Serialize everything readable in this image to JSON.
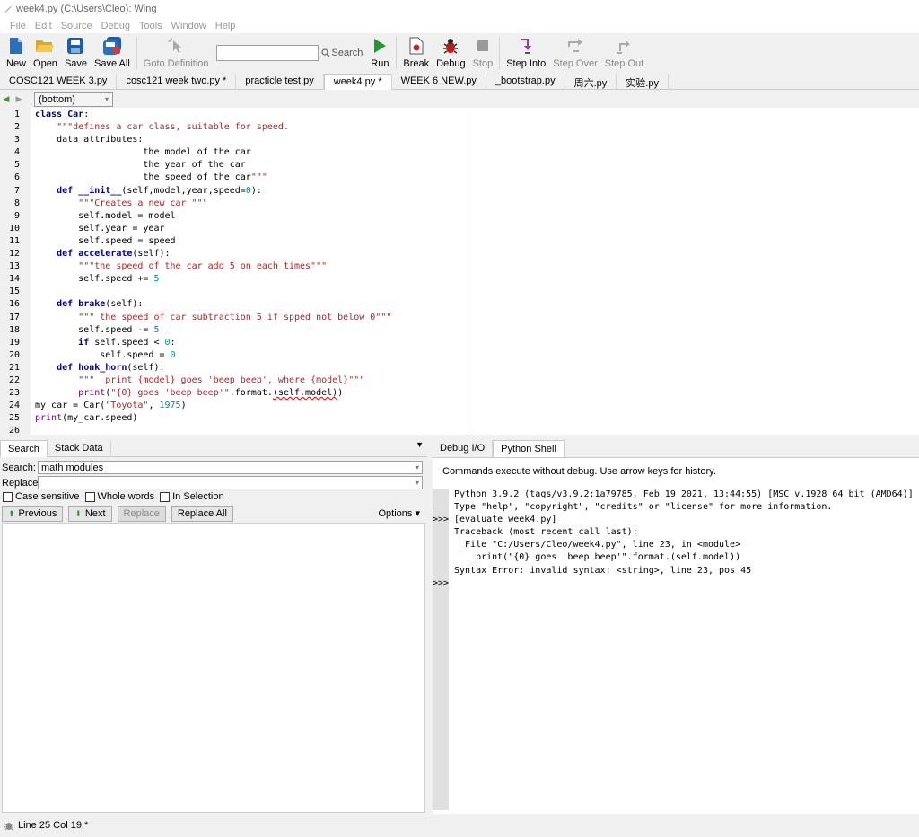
{
  "window": {
    "title": "week4.py (C:\\Users\\Cleo): Wing"
  },
  "menubar": [
    "File",
    "Edit",
    "Source",
    "Debug",
    "Tools",
    "Window",
    "Help"
  ],
  "toolbar": {
    "new": "New",
    "open": "Open",
    "save": "Save",
    "save_all": "Save All",
    "goto_definition": "Goto Definition",
    "search_label": "Search",
    "run": "Run",
    "break": "Break",
    "debug": "Debug",
    "stop": "Stop",
    "step_into": "Step Into",
    "step_over": "Step Over",
    "step_out": "Step Out"
  },
  "editor_tabs": [
    {
      "label": "COSC121 WEEK 3.py"
    },
    {
      "label": "cosc121 week two.py *"
    },
    {
      "label": "practicle test.py"
    },
    {
      "label": "week4.py *"
    },
    {
      "label": "WEEK 6 NEW.py"
    },
    {
      "label": "_bootstrap.py"
    },
    {
      "label": "周六.py"
    },
    {
      "label": "实验.py"
    }
  ],
  "scope": {
    "value": "(bottom)"
  },
  "code_lines": [
    "class Car:",
    "    \"\"\"defines a car class, suitable for speed.",
    "    data attributes:",
    "                    the model of the car",
    "                    the year of the car",
    "                    the speed of the car\"\"\"",
    "    def __init__(self,model,year,speed=0):",
    "        \"\"\"Creates a new car \"\"\"",
    "        self.model = model",
    "        self.year = year",
    "        self.speed = speed",
    "    def accelerate(self):",
    "        \"\"\"the speed of the car add 5 on each times\"\"\"",
    "        self.speed += 5",
    "",
    "    def brake(self):",
    "        \"\"\" the speed of car subtraction 5 if spped not below 0\"\"\"",
    "        self.speed -= 5",
    "        if self.speed < 0:",
    "            self.speed = 0",
    "    def honk_horn(self):",
    "        \"\"\"  print {model} goes 'beep beep', where {model}\"\"\"",
    "        print(\"{0} goes 'beep beep'\".format.(self.model))",
    "my_car = Car(\"Toyota\", 1975)",
    "print(my_car.speed)",
    ""
  ],
  "search_panel": {
    "tabs": [
      "Search",
      "Stack Data"
    ],
    "search_label": "Search:",
    "search_value": "math modules",
    "replace_label": "Replace:",
    "replace_value": "",
    "case_sensitive": "Case sensitive",
    "whole_words": "Whole words",
    "in_selection": "In Selection",
    "previous": "Previous",
    "next": "Next",
    "replace": "Replace",
    "replace_all": "Replace All",
    "options": "Options"
  },
  "shell_panel": {
    "tabs": [
      "Debug I/O",
      "Python Shell"
    ],
    "hint": "Commands execute without debug.  Use arrow keys for history.",
    "lines": [
      {
        "prompt": "",
        "text": "Python 3.9.2 (tags/v3.9.2:1a79785, Feb 19 2021, 13:44:55) [MSC v.1928 64 bit (AMD64)]"
      },
      {
        "prompt": "",
        "text": "Type \"help\", \"copyright\", \"credits\" or \"license\" for more information."
      },
      {
        "prompt": ">>>",
        "text": "[evaluate week4.py]"
      },
      {
        "prompt": "",
        "text": "Traceback (most recent call last):"
      },
      {
        "prompt": "",
        "text": "  File \"C:/Users/Cleo/week4.py\", line 23, in <module>"
      },
      {
        "prompt": "",
        "text": "    print(\"{0} goes 'beep beep'\".format.(self.model))"
      },
      {
        "prompt": "",
        "text": "Syntax Error: invalid syntax: <string>, line 23, pos 45"
      },
      {
        "prompt": ">>>",
        "text": ""
      }
    ]
  },
  "status": {
    "text": "Line 25 Col 19 *"
  },
  "colors": {
    "keyword": "#00008b",
    "string": "#a52a2a",
    "number": "#008b8b",
    "builtin": "#8b008b",
    "edge": "#e5736e"
  }
}
